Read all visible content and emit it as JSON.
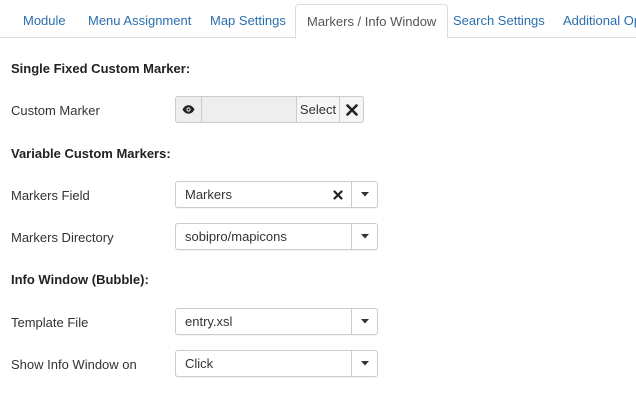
{
  "tabs": [
    {
      "label": "Module",
      "active": false
    },
    {
      "label": "Menu Assignment",
      "active": false
    },
    {
      "label": "Map Settings",
      "active": false
    },
    {
      "label": "Markers / Info Window",
      "active": true
    },
    {
      "label": "Search Settings",
      "active": false
    },
    {
      "label": "Additional Op",
      "active": false
    }
  ],
  "sections": {
    "single_marker": "Single Fixed Custom Marker:",
    "variable_markers": "Variable Custom Markers:",
    "info_window": "Info Window (Bubble):"
  },
  "fields": {
    "custom_marker": {
      "label": "Custom Marker",
      "value": "",
      "select_label": "Select",
      "icons": [
        "eye-icon",
        "close-icon"
      ]
    },
    "markers_field": {
      "label": "Markers Field",
      "value": "Markers",
      "icons": [
        "clear-icon",
        "caret-down-icon"
      ]
    },
    "markers_directory": {
      "label": "Markers Directory",
      "value": "sobipro/mapicons"
    },
    "template_file": {
      "label": "Template File",
      "value": "entry.xsl"
    },
    "show_info_window": {
      "label": "Show Info Window on",
      "value": "Click"
    }
  },
  "colors": {
    "link": "#2a6fb0",
    "border": "#cccccc",
    "active_tab_text": "#555555"
  }
}
